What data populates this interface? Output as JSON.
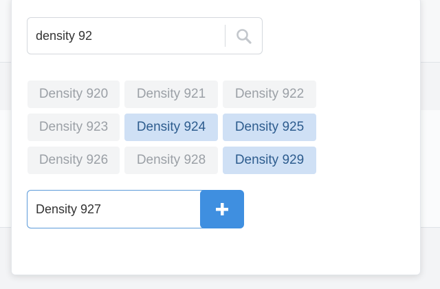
{
  "search": {
    "value": "density 92",
    "icon": "search-icon"
  },
  "chips": [
    {
      "label": "Density 920",
      "selected": false
    },
    {
      "label": "Density 921",
      "selected": false
    },
    {
      "label": "Density 922",
      "selected": false
    },
    {
      "label": "Density 923",
      "selected": false
    },
    {
      "label": "Density 924",
      "selected": true
    },
    {
      "label": "Density 925",
      "selected": true
    },
    {
      "label": "Density 926",
      "selected": false
    },
    {
      "label": "Density 928",
      "selected": false
    },
    {
      "label": "Density 929",
      "selected": true
    }
  ],
  "add": {
    "value": "Density 927",
    "button_icon": "plus-icon"
  },
  "colors": {
    "accent": "#3f8fe0",
    "selected_bg": "#cfe0f5",
    "selected_text": "#2d5c8e",
    "unselected_bg": "#f3f4f5",
    "unselected_text": "#9ba0a6"
  }
}
